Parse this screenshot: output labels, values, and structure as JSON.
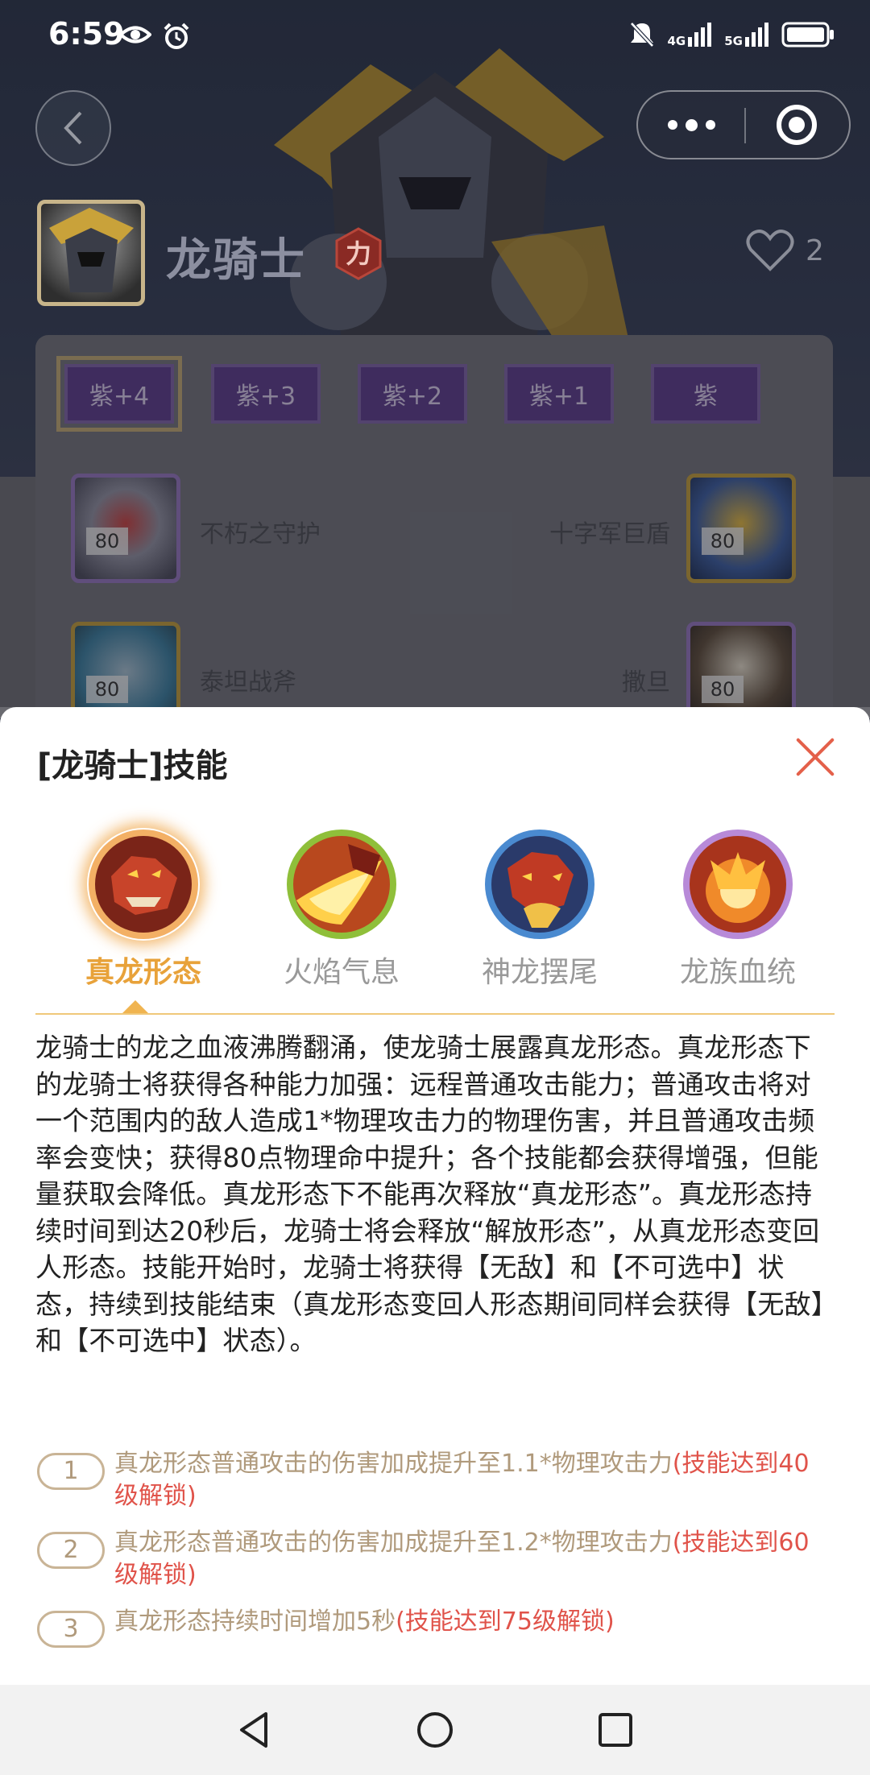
{
  "status_bar": {
    "time": "6:59",
    "network_1": "4G",
    "network_2": "5G",
    "icons": [
      "eye-icon",
      "alarm-icon",
      "mute-icon",
      "signal-icon",
      "battery-icon"
    ]
  },
  "hero": {
    "name": "龙骑士",
    "class_badge": "力",
    "likes": "2"
  },
  "equipment": {
    "ranks": [
      "紫+4",
      "紫+3",
      "紫+2",
      "紫+1",
      "紫"
    ],
    "rows": [
      {
        "left_name": "不朽之守护",
        "left_level": "80",
        "right_name": "十字军巨盾",
        "right_level": "80"
      },
      {
        "left_name": "泰坦战斧",
        "left_level": "80",
        "right_name": "撒旦",
        "right_level": "80"
      }
    ]
  },
  "sheet": {
    "title": "[龙骑士]技能",
    "skills": [
      {
        "label": "真龙形态",
        "active": true
      },
      {
        "label": "火焰气息",
        "active": false
      },
      {
        "label": "神龙摆尾",
        "active": false
      },
      {
        "label": "龙族血统",
        "active": false
      }
    ],
    "description": "龙骑士的龙之血液沸腾翻涌，使龙骑士展露真龙形态。真龙形态下的龙骑士将获得各种能力加强：远程普通攻击能力；普通攻击将对一个范围内的敌人造成1*物理攻击力的物理伤害，并且普通攻击频率会变快；获得80点物理命中提升；各个技能都会获得增强，但能量获取会降低。真龙形态下不能再次释放“真龙形态”。真龙形态持续时间到达20秒后，龙骑士将会释放“解放形态”，从真龙形态变回人形态。技能开始时，龙骑士将获得【无敌】和【不可选中】状态，持续到技能结束（真龙形态变回人形态期间同样会获得【无敌】和【不可选中】状态）。",
    "upgrades": [
      {
        "num": "1",
        "text": "真龙形态普通攻击的伤害加成提升至1.1*物理攻击力",
        "unlock": "(技能达到40级解锁)"
      },
      {
        "num": "2",
        "text": "真龙形态普通攻击的伤害加成提升至1.2*物理攻击力",
        "unlock": "(技能达到60级解锁)"
      },
      {
        "num": "3",
        "text": "真龙形态持续时间增加5秒",
        "unlock": "(技能达到75级解锁)"
      }
    ]
  },
  "colors": {
    "accent": "#e8a23a",
    "unlock_red": "#e0534a",
    "upgrade_text": "#b09a7c",
    "close_red": "#e4604a"
  }
}
